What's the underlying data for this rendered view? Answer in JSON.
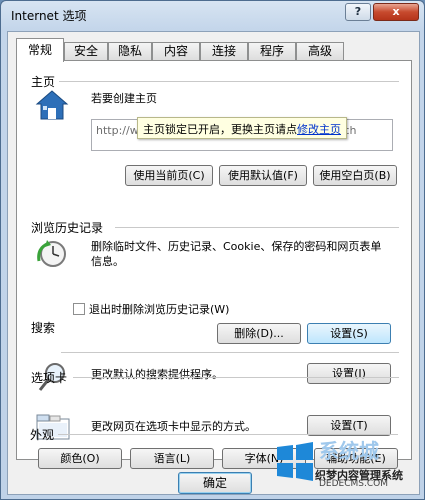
{
  "window": {
    "title": "Internet 选项",
    "help_label": "?",
    "close_label": "x"
  },
  "tabs": [
    {
      "label": "常规",
      "active": true
    },
    {
      "label": "安全"
    },
    {
      "label": "隐私"
    },
    {
      "label": "内容"
    },
    {
      "label": "连接"
    },
    {
      "label": "程序"
    },
    {
      "label": "高级"
    }
  ],
  "homepage": {
    "title": "主页",
    "desc": "若要创建主页",
    "url": "http://www.baidu.com/?tn=98012088_4_dg&ch",
    "tooltip_text": "主页锁定已开启，更换主页请点",
    "tooltip_link": "修改主页",
    "btn_current": "使用当前页(C)",
    "btn_default": "使用默认值(F)",
    "btn_blank": "使用空白页(B)"
  },
  "history": {
    "title": "浏览历史记录",
    "desc": "删除临时文件、历史记录、Cookie、保存的密码和网页表单信息。",
    "checkbox_label": "退出时删除浏览历史记录(W)",
    "btn_delete": "删除(D)...",
    "btn_settings": "设置(S)"
  },
  "search": {
    "title": "搜索",
    "desc": "更改默认的搜索提供程序。",
    "btn_settings": "设置(I)"
  },
  "tabs_section": {
    "title": "选项卡",
    "desc": "更改网页在选项卡中显示的方式。",
    "btn_settings": "设置(T)"
  },
  "appearance": {
    "title": "外观",
    "btn_colors": "颜色(O)",
    "btn_languages": "语言(L)",
    "btn_fonts": "字体(N)",
    "btn_accessibility": "辅助功能(E)"
  },
  "footer": {
    "ok_label": "确定"
  },
  "watermark": {
    "text1": "系统城",
    "text2": "织梦内容管理系统",
    "text3": "DEDECMS.COM"
  }
}
